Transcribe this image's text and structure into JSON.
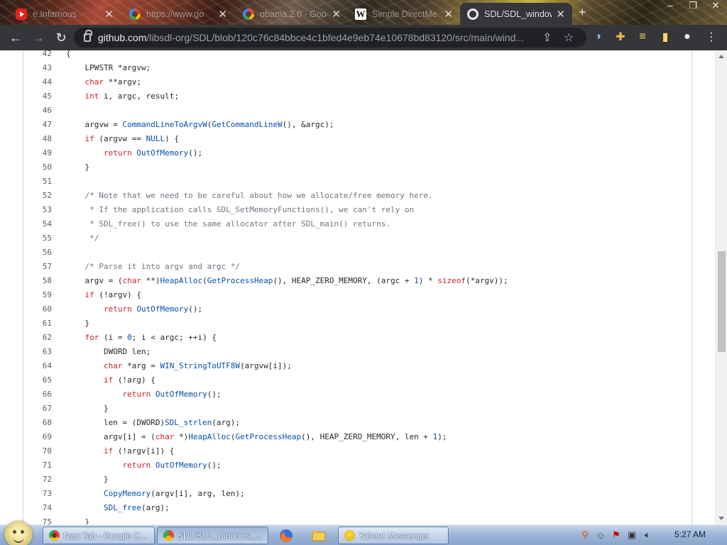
{
  "browser": {
    "tabs": [
      {
        "title": "e.Infamous",
        "favicon": "youtube-icon",
        "active": false
      },
      {
        "title": "https://www.go",
        "favicon": "google-icon",
        "active": false
      },
      {
        "title": "obama 2.0 - Goo",
        "favicon": "google-icon",
        "active": false
      },
      {
        "title": "Simple DirectMe",
        "favicon": "wikipedia-icon",
        "active": false
      },
      {
        "title": "SDL/SDL_window",
        "favicon": "github-icon",
        "active": true
      }
    ],
    "url_host": "github.com",
    "url_path": "/libsdl-org/SDL/blob/120c76c84bbce4c1bfed4e9eb74e10678bd83120/src/main/wind...",
    "colors": {
      "chrome_bg": "#35363a",
      "omnibox_bg": "#202124",
      "keyword": "#cf222e",
      "function": "#0550ae",
      "comment": "#6e7781"
    }
  },
  "code": {
    "lines": [
      {
        "n": "42",
        "parts": [
          {
            "t": "{",
            "c": ""
          }
        ]
      },
      {
        "n": "43",
        "parts": [
          {
            "t": "    LPWSTR *argvw;",
            "c": ""
          }
        ]
      },
      {
        "n": "44",
        "parts": [
          {
            "t": "    ",
            "c": ""
          },
          {
            "t": "char",
            "c": "kw"
          },
          {
            "t": " **argv;",
            "c": ""
          }
        ]
      },
      {
        "n": "45",
        "parts": [
          {
            "t": "    ",
            "c": ""
          },
          {
            "t": "int",
            "c": "kw"
          },
          {
            "t": " i, argc, result;",
            "c": ""
          }
        ]
      },
      {
        "n": "46",
        "parts": []
      },
      {
        "n": "47",
        "parts": [
          {
            "t": "    argvw = ",
            "c": ""
          },
          {
            "t": "CommandLineToArgvW",
            "c": "fn"
          },
          {
            "t": "(",
            "c": ""
          },
          {
            "t": "GetCommandLineW",
            "c": "fn"
          },
          {
            "t": "(), &argc);",
            "c": ""
          }
        ]
      },
      {
        "n": "48",
        "parts": [
          {
            "t": "    ",
            "c": ""
          },
          {
            "t": "if",
            "c": "kw"
          },
          {
            "t": " (argvw == ",
            "c": ""
          },
          {
            "t": "NULL",
            "c": "fn"
          },
          {
            "t": ") {",
            "c": ""
          }
        ]
      },
      {
        "n": "49",
        "parts": [
          {
            "t": "        ",
            "c": ""
          },
          {
            "t": "return",
            "c": "kw"
          },
          {
            "t": " ",
            "c": ""
          },
          {
            "t": "OutOfMemory",
            "c": "fn"
          },
          {
            "t": "();",
            "c": ""
          }
        ]
      },
      {
        "n": "50",
        "parts": [
          {
            "t": "    }",
            "c": ""
          }
        ]
      },
      {
        "n": "51",
        "parts": []
      },
      {
        "n": "52",
        "parts": [
          {
            "t": "    /* Note that we need to be careful about how we allocate/free memory here.",
            "c": "cm"
          }
        ]
      },
      {
        "n": "53",
        "parts": [
          {
            "t": "     * If the application calls SDL_SetMemoryFunctions(), we can't rely on",
            "c": "cm"
          }
        ]
      },
      {
        "n": "54",
        "parts": [
          {
            "t": "     * SDL_free() to use the same allocator after SDL_main() returns.",
            "c": "cm"
          }
        ]
      },
      {
        "n": "55",
        "parts": [
          {
            "t": "     */",
            "c": "cm"
          }
        ]
      },
      {
        "n": "56",
        "parts": []
      },
      {
        "n": "57",
        "parts": [
          {
            "t": "    /* Parse it into argv and argc */",
            "c": "cm"
          }
        ]
      },
      {
        "n": "58",
        "parts": [
          {
            "t": "    argv = (",
            "c": ""
          },
          {
            "t": "char",
            "c": "kw"
          },
          {
            "t": " **)",
            "c": ""
          },
          {
            "t": "HeapAlloc",
            "c": "fn"
          },
          {
            "t": "(",
            "c": ""
          },
          {
            "t": "GetProcessHeap",
            "c": "fn"
          },
          {
            "t": "(), HEAP_ZERO_MEMORY, (argc + ",
            "c": ""
          },
          {
            "t": "1",
            "c": "num"
          },
          {
            "t": ") * ",
            "c": ""
          },
          {
            "t": "sizeof",
            "c": "kw"
          },
          {
            "t": "(*argv));",
            "c": ""
          }
        ]
      },
      {
        "n": "59",
        "parts": [
          {
            "t": "    ",
            "c": ""
          },
          {
            "t": "if",
            "c": "kw"
          },
          {
            "t": " (!argv) {",
            "c": ""
          }
        ]
      },
      {
        "n": "60",
        "parts": [
          {
            "t": "        ",
            "c": ""
          },
          {
            "t": "return",
            "c": "kw"
          },
          {
            "t": " ",
            "c": ""
          },
          {
            "t": "OutOfMemory",
            "c": "fn"
          },
          {
            "t": "();",
            "c": ""
          }
        ]
      },
      {
        "n": "61",
        "parts": [
          {
            "t": "    }",
            "c": ""
          }
        ]
      },
      {
        "n": "62",
        "parts": [
          {
            "t": "    ",
            "c": ""
          },
          {
            "t": "for",
            "c": "kw"
          },
          {
            "t": " (i = ",
            "c": ""
          },
          {
            "t": "0",
            "c": "num"
          },
          {
            "t": "; i < argc; ++i) {",
            "c": ""
          }
        ]
      },
      {
        "n": "63",
        "parts": [
          {
            "t": "        DWORD len;",
            "c": ""
          }
        ]
      },
      {
        "n": "64",
        "parts": [
          {
            "t": "        ",
            "c": ""
          },
          {
            "t": "char",
            "c": "kw"
          },
          {
            "t": " *arg = ",
            "c": ""
          },
          {
            "t": "WIN_StringToUTF8W",
            "c": "fn"
          },
          {
            "t": "(argvw[i]);",
            "c": ""
          }
        ]
      },
      {
        "n": "65",
        "parts": [
          {
            "t": "        ",
            "c": ""
          },
          {
            "t": "if",
            "c": "kw"
          },
          {
            "t": " (!arg) {",
            "c": ""
          }
        ]
      },
      {
        "n": "66",
        "parts": [
          {
            "t": "            ",
            "c": ""
          },
          {
            "t": "return",
            "c": "kw"
          },
          {
            "t": " ",
            "c": ""
          },
          {
            "t": "OutOfMemory",
            "c": "fn"
          },
          {
            "t": "();",
            "c": ""
          }
        ]
      },
      {
        "n": "67",
        "parts": [
          {
            "t": "        }",
            "c": ""
          }
        ]
      },
      {
        "n": "68",
        "parts": [
          {
            "t": "        len = (DWORD)",
            "c": ""
          },
          {
            "t": "SDL_strlen",
            "c": "fn"
          },
          {
            "t": "(arg);",
            "c": ""
          }
        ]
      },
      {
        "n": "69",
        "parts": [
          {
            "t": "        argv[i] = (",
            "c": ""
          },
          {
            "t": "char",
            "c": "kw"
          },
          {
            "t": " *)",
            "c": ""
          },
          {
            "t": "HeapAlloc",
            "c": "fn"
          },
          {
            "t": "(",
            "c": ""
          },
          {
            "t": "GetProcessHeap",
            "c": "fn"
          },
          {
            "t": "(), HEAP_ZERO_MEMORY, len + ",
            "c": ""
          },
          {
            "t": "1",
            "c": "num"
          },
          {
            "t": ");",
            "c": ""
          }
        ]
      },
      {
        "n": "70",
        "parts": [
          {
            "t": "        ",
            "c": ""
          },
          {
            "t": "if",
            "c": "kw"
          },
          {
            "t": " (!argv[i]) {",
            "c": ""
          }
        ]
      },
      {
        "n": "71",
        "parts": [
          {
            "t": "            ",
            "c": ""
          },
          {
            "t": "return",
            "c": "kw"
          },
          {
            "t": " ",
            "c": ""
          },
          {
            "t": "OutOfMemory",
            "c": "fn"
          },
          {
            "t": "();",
            "c": ""
          }
        ]
      },
      {
        "n": "72",
        "parts": [
          {
            "t": "        }",
            "c": ""
          }
        ]
      },
      {
        "n": "73",
        "parts": [
          {
            "t": "        ",
            "c": ""
          },
          {
            "t": "CopyMemory",
            "c": "fn"
          },
          {
            "t": "(argv[i], arg, len);",
            "c": ""
          }
        ]
      },
      {
        "n": "74",
        "parts": [
          {
            "t": "        ",
            "c": ""
          },
          {
            "t": "SDL_free",
            "c": "fn"
          },
          {
            "t": "(arg);",
            "c": ""
          }
        ]
      },
      {
        "n": "75",
        "parts": [
          {
            "t": "    }",
            "c": ""
          }
        ]
      }
    ]
  },
  "taskbar": {
    "buttons": [
      {
        "label": "New Tab - Google C...",
        "icon": "chrome-icon"
      },
      {
        "label": "SDL/SDL_windows_...",
        "icon": "chrome-icon"
      },
      {
        "label": "Yahoo! Messenger",
        "icon": "yahoo-messenger-icon"
      }
    ],
    "clock": "5:27 AM"
  }
}
